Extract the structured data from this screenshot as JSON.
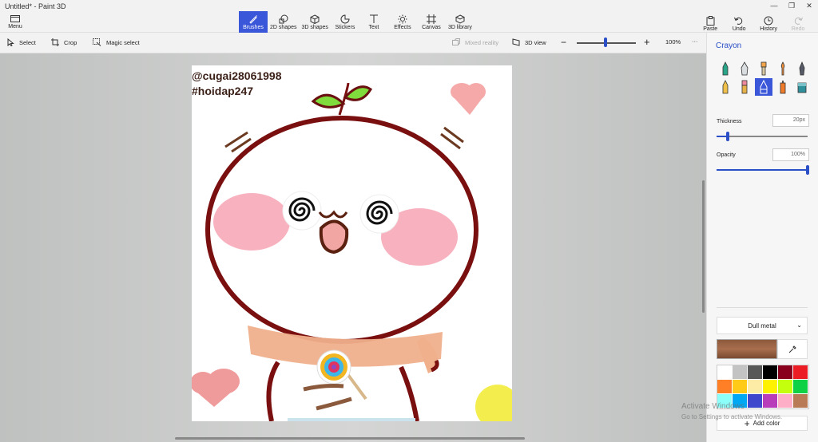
{
  "window": {
    "title": "Untitled* - Paint 3D",
    "controls": [
      "—",
      "❐",
      "✕"
    ]
  },
  "menu": {
    "label": "Menu"
  },
  "tools": [
    {
      "label": "Brushes",
      "icon": "brush-icon",
      "active": true
    },
    {
      "label": "2D shapes",
      "icon": "2d-shapes-icon"
    },
    {
      "label": "3D shapes",
      "icon": "3d-shapes-icon"
    },
    {
      "label": "Stickers",
      "icon": "stickers-icon"
    },
    {
      "label": "Text",
      "icon": "text-icon"
    },
    {
      "label": "Effects",
      "icon": "effects-icon"
    },
    {
      "label": "Canvas",
      "icon": "canvas-icon"
    },
    {
      "label": "3D library",
      "icon": "3d-library-icon"
    }
  ],
  "right_tools": {
    "paste": "Paste",
    "undo": "Undo",
    "history": "History",
    "redo": "Redo"
  },
  "subbar": {
    "select": "Select",
    "crop": "Crop",
    "magic_select": "Magic select",
    "mixed_reality": "Mixed reality",
    "view_3d": "3D view",
    "zoom": "100%",
    "zoom_level": 0.48,
    "more": "···"
  },
  "canvas_text": {
    "line1": "@cugai28061998",
    "line2": "#hoidap247"
  },
  "panel": {
    "title": "Crayon",
    "thickness_label": "Thickness",
    "thickness_value": "20px",
    "thickness_level": 0.12,
    "opacity_label": "Opacity",
    "opacity_value": "100%",
    "opacity_level": 1.0,
    "texture": "Dull metal",
    "add_color": "Add color"
  },
  "palette": [
    "#ffffff",
    "#c3c3c3",
    "#585858",
    "#000000",
    "#88001b",
    "#ec1c24",
    "#ff7f27",
    "#ffca18",
    "#fdeca6",
    "#fff200",
    "#c4ff0e",
    "#0ed145",
    "#8cfffb",
    "#00a8f3",
    "#3f48cc",
    "#b83dba",
    "#ffaec8",
    "#b97a56"
  ],
  "windows_notice": {
    "line1": "Activate Windows",
    "line2": "Go to Settings to activate Windows."
  }
}
